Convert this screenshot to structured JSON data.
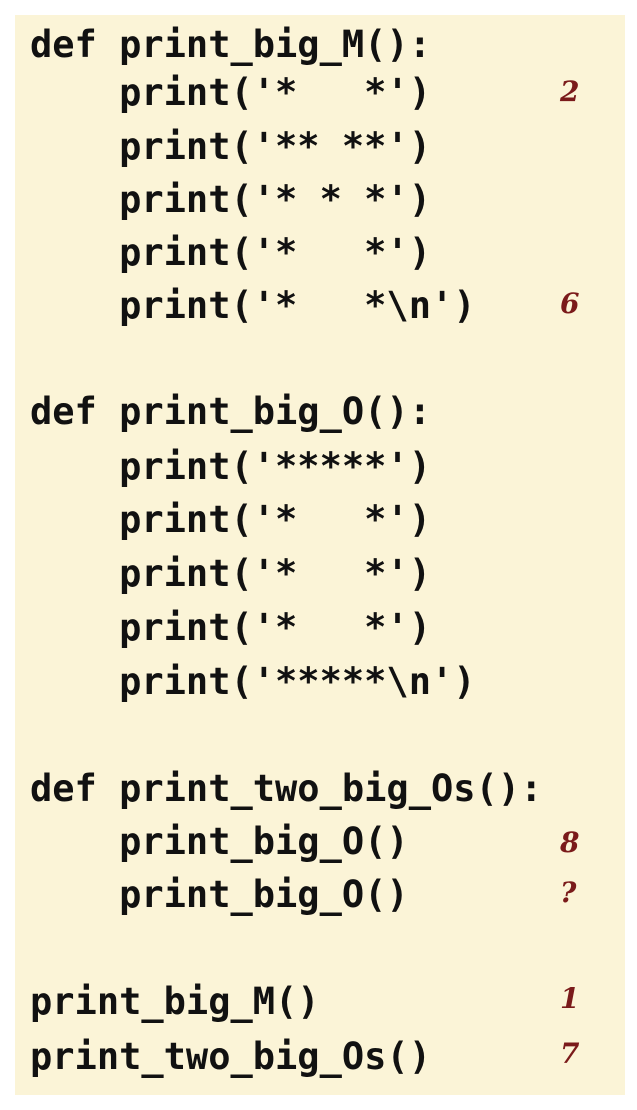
{
  "code": {
    "lines": [
      "def print_big_M():",
      "    print('*   *')",
      "    print('** **')",
      "    print('* * *')",
      "    print('*   *')",
      "    print('*   *\\n')",
      "",
      "def print_big_O():",
      "    print('*****')",
      "    print('*   *')",
      "    print('*   *')",
      "    print('*   *')",
      "    print('*****\\n')",
      "",
      "def print_two_big_Os():",
      "    print_big_O()",
      "    print_big_O()",
      "",
      "print_big_M()",
      "print_two_big_Os()"
    ]
  },
  "annotations": [
    "2",
    "6",
    "8",
    "?",
    "1",
    "7"
  ],
  "colors": {
    "panel_background": "#fbf4d7",
    "code_text": "#111111",
    "annotation_text": "#7a1a1a"
  }
}
